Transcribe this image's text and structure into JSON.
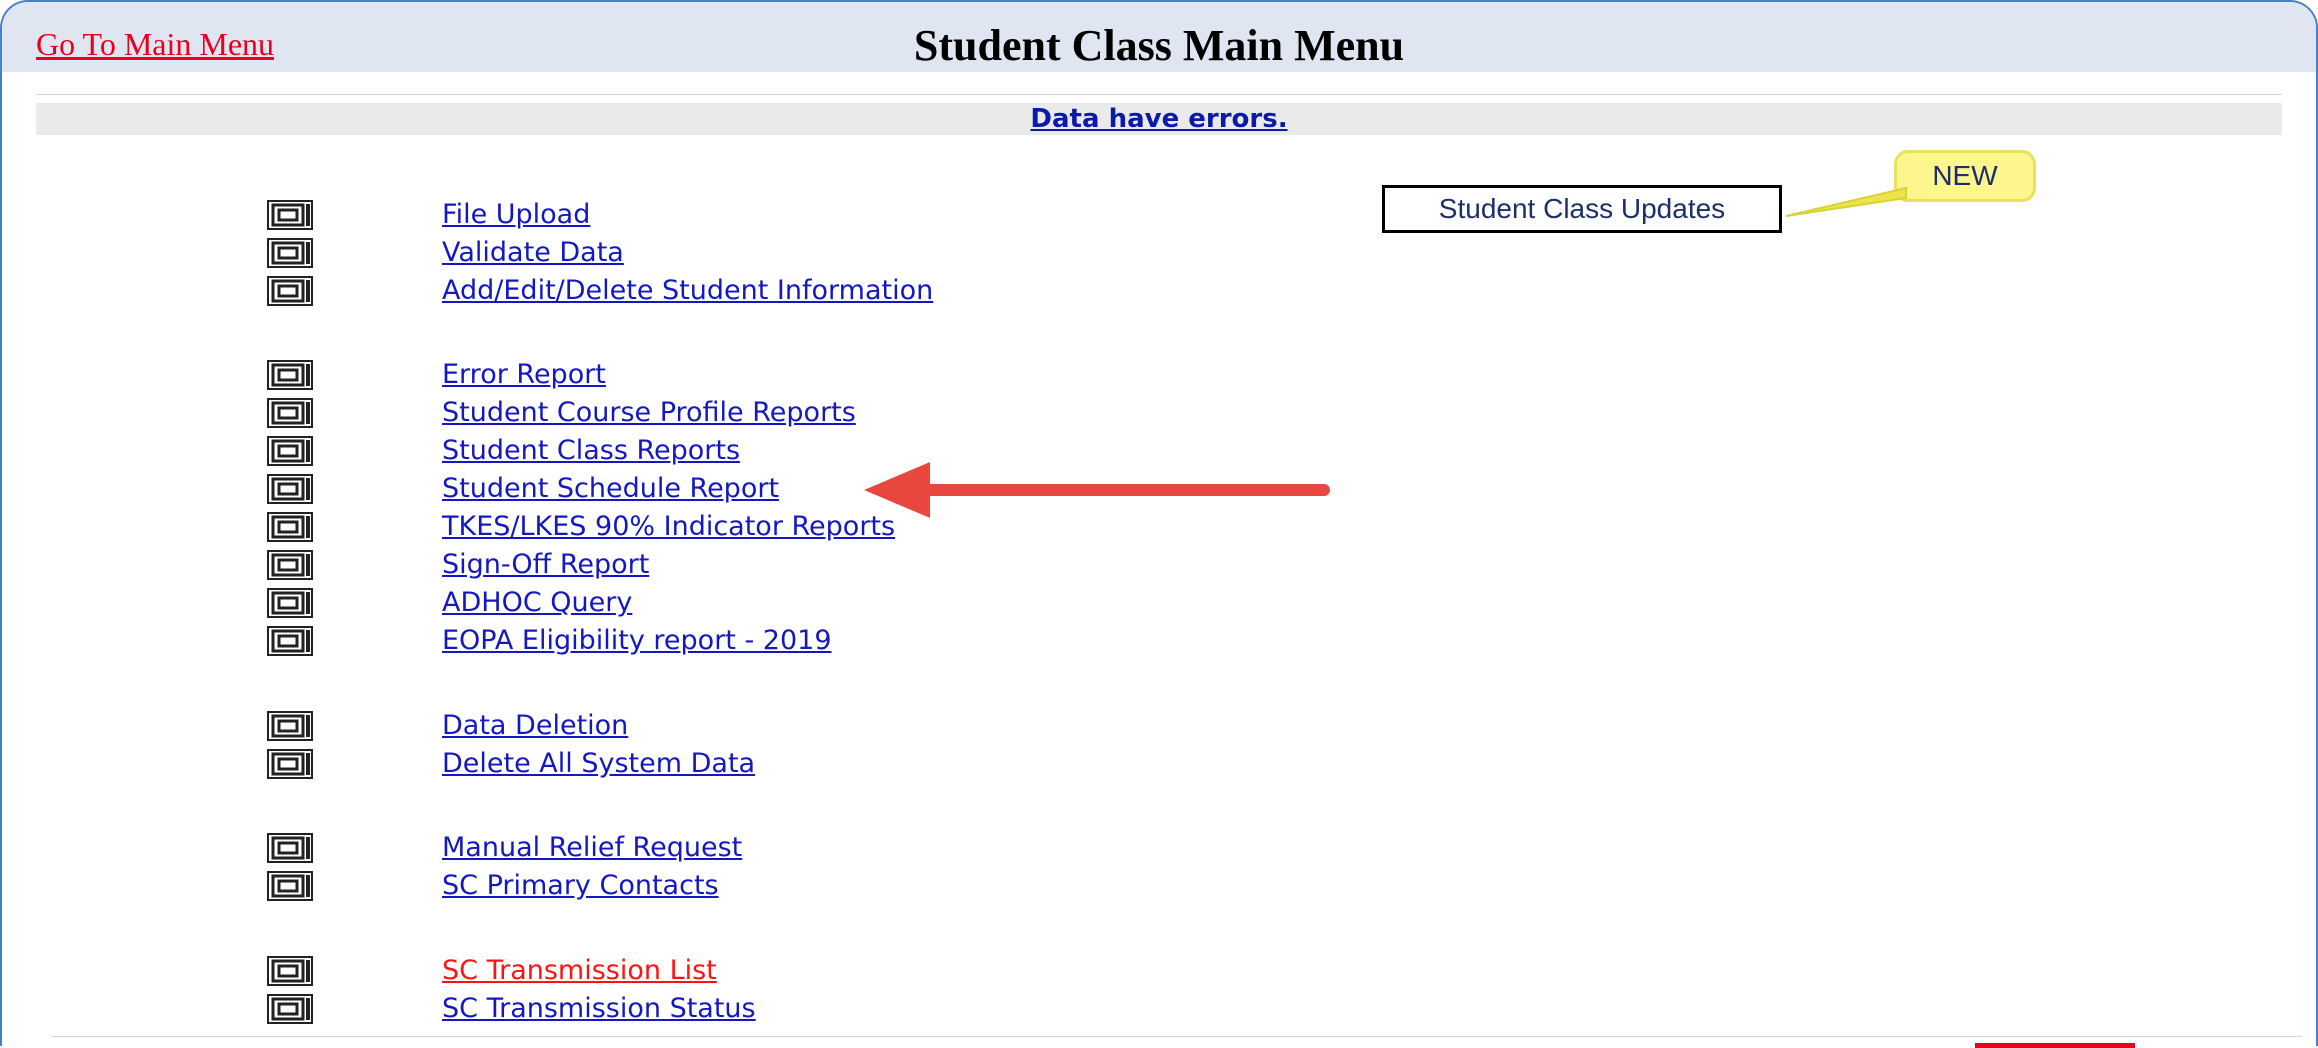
{
  "header": {
    "main_menu_link": "Go To Main Menu",
    "title": "Student Class Main Menu"
  },
  "status": {
    "error_message": "Data have errors."
  },
  "menu": {
    "items": [
      {
        "label": "File Upload"
      },
      {
        "label": "Validate Data"
      },
      {
        "label": "Add/Edit/Delete Student Information"
      },
      {
        "label": "Error Report"
      },
      {
        "label": "Student Course Profile Reports"
      },
      {
        "label": "Student Class Reports"
      },
      {
        "label": "Student Schedule Report"
      },
      {
        "label": "TKES/LKES 90% Indicator Reports"
      },
      {
        "label": "Sign-Off Report"
      },
      {
        "label": "ADHOC Query"
      },
      {
        "label": "EOPA Eligibility report - 2019"
      },
      {
        "label": "Data Deletion"
      },
      {
        "label": "Delete All System Data"
      },
      {
        "label": "Manual Relief Request"
      },
      {
        "label": "SC Primary Contacts"
      },
      {
        "label": "SC Transmission List"
      },
      {
        "label": "SC Transmission Status"
      }
    ]
  },
  "annotations": {
    "updates_box": "Student Class Updates",
    "new_badge": "NEW",
    "highlight_color": "#e8473f"
  },
  "colors": {
    "link": "#1318c0",
    "header_link": "#e8001c",
    "header_bg": "#dfe6f1"
  }
}
